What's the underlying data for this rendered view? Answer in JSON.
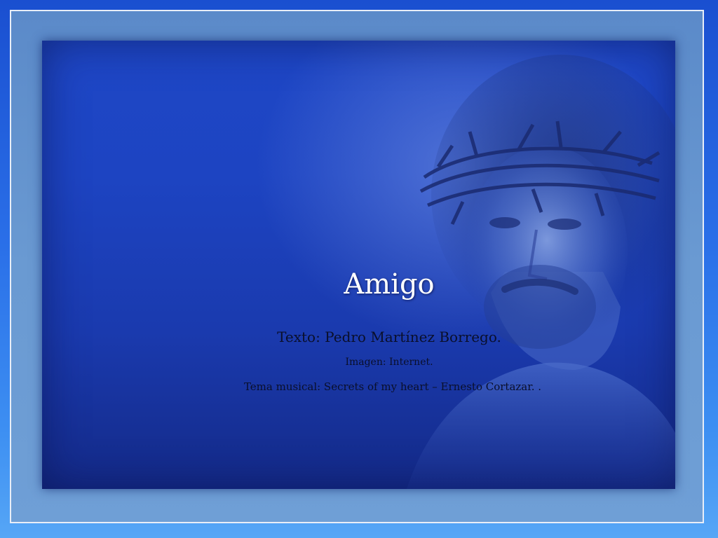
{
  "slide": {
    "title": "Amigo",
    "author_line": "Texto: Pedro  Martínez  Borrego.",
    "image_credit": "Imagen: Internet.",
    "music_credit": "Tema musical: Secrets of my heart – Ernesto Cortazar.  ."
  },
  "colors": {
    "background_top": "#1a4fd0",
    "background_bottom": "#56a6f6",
    "frame_mat": "#6a9ad2",
    "photo_blue": "#1d44c2",
    "title_text": "#ffffff",
    "body_text": "#0a0f2a"
  },
  "image": {
    "subject": "portrait-with-crown-of-thorns"
  }
}
